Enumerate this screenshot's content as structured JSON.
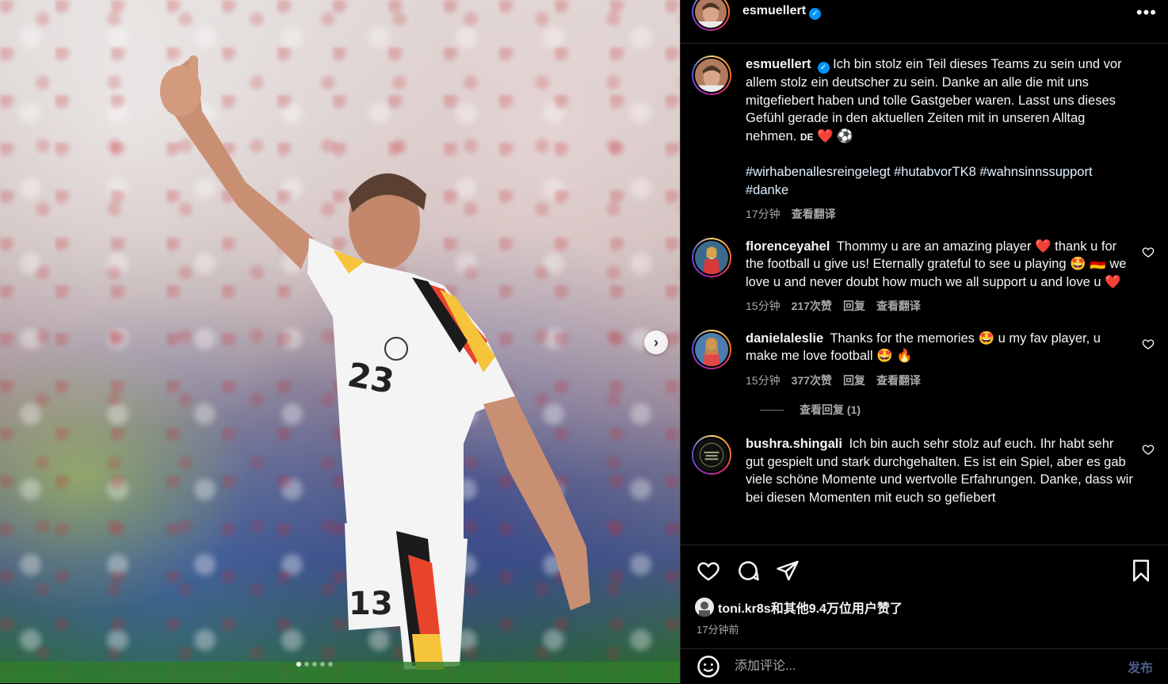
{
  "post": {
    "author": "esmuellert",
    "verified_icon": "verified-badge-icon",
    "more_label": "•••",
    "caption_text": "Ich bin stolz ein Teil dieses Teams zu sein und vor allem stolz ein deutscher zu sein. Danke an alle die mit uns mitgefiebert haben und tolle Gastgeber waren. Lasst uns dieses Gefühl gerade in den aktuellen Zeiten mit in unseren Alltag nehmen.",
    "caption_flag": "DE",
    "caption_emojis": "❤️ ⚽",
    "hashtags": "#wirhabenallesreingelegt #hutabvorTK8 #wahnsinnssupport #danke",
    "caption_time": "17分钟",
    "caption_translate": "查看翻译"
  },
  "comments": [
    {
      "author": "florenceyahel",
      "text": "Thommy u are an amazing player ❤️  thank u for the football u give us! Eternally grateful to see u playing 🤩 🇩🇪 we love u and never doubt how much we all support u and love u ❤️",
      "time": "15分钟",
      "likes": "217次赞",
      "reply": "回复",
      "translate": "查看翻译"
    },
    {
      "author": "danielaleslie",
      "text": "Thanks for the memories 🤩  u my fav player, u make me love football 🤩 🔥",
      "time": "15分钟",
      "likes": "377次赞",
      "reply": "回复",
      "translate": "查看翻译",
      "view_replies": "查看回复 (1)"
    },
    {
      "author": "bushra.shingali",
      "text": "Ich bin auch sehr stolz auf euch. Ihr habt sehr gut gespielt und stark durchgehalten. Es ist ein Spiel, aber es gab viele schöne Momente und wertvolle Erfahrungen. Danke, dass wir bei diesen Momenten mit euch so gefiebert"
    }
  ],
  "footer": {
    "likes_text": "toni.kr8s和其他9.4万位用户赞了",
    "post_time": "17分钟前",
    "comment_placeholder": "添加评论...",
    "post_label": "发布"
  },
  "carousel": {
    "next_label": "›",
    "total_slides": 5,
    "active_slide": 1
  },
  "colors": {
    "accent_link": "#e0f1ff",
    "verified": "#0095f6",
    "like_red": "#ff3040"
  }
}
